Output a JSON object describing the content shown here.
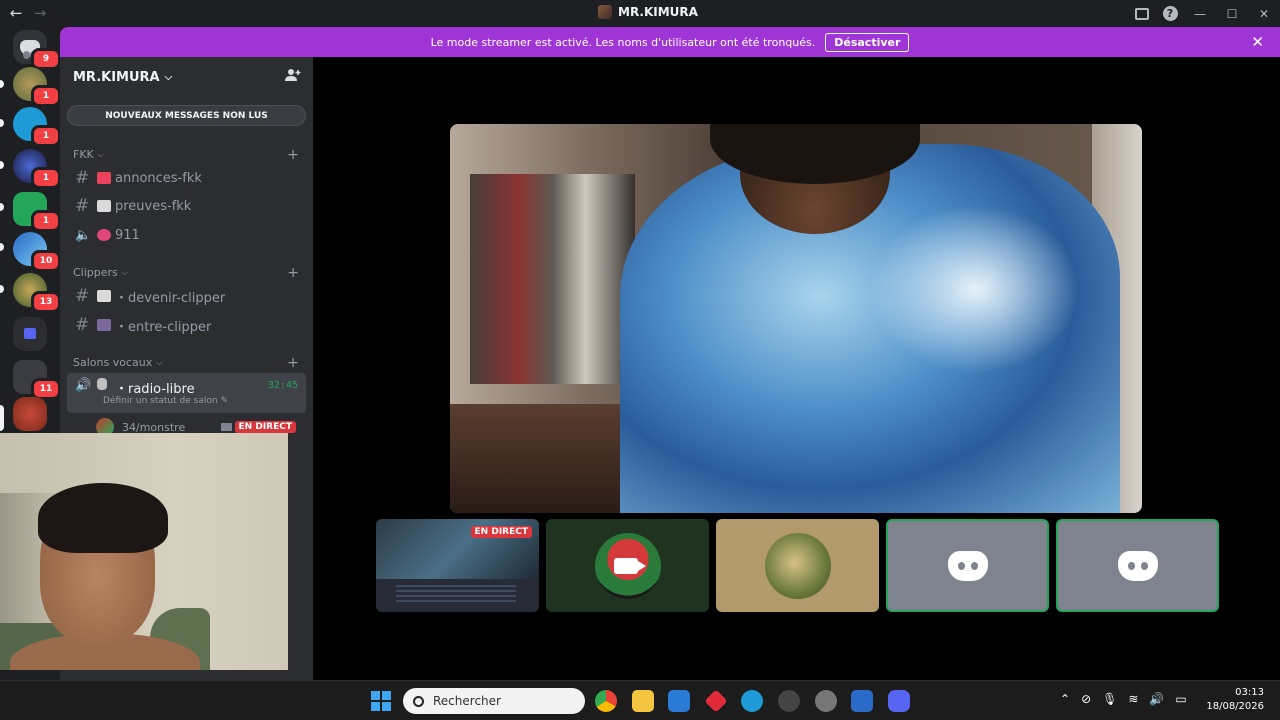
{
  "titlebar": {
    "title": "MR.KIMURA",
    "back_glyph": "←",
    "forward_glyph": "→",
    "minimize": "—",
    "maximize": "☐",
    "close": "✕",
    "help": "?"
  },
  "banner": {
    "message": "Le mode streamer est activé. Les noms d'utilisateur ont été tronqués.",
    "button": "Désactiver",
    "close": "✕"
  },
  "rail": {
    "badges": [
      "9",
      "1",
      "1",
      "1",
      "1",
      "10",
      "13",
      "11"
    ]
  },
  "sidebar": {
    "server_name": "MR.KIMURA",
    "chevron": "⌵",
    "unread_button": "NOUVEAUX MESSAGES NON LUS",
    "categories": [
      {
        "name": "FKK",
        "plus": "+"
      },
      {
        "name": "Clippers",
        "plus": "+"
      },
      {
        "name": "Salons vocaux",
        "plus": "+"
      }
    ],
    "channels": [
      {
        "name": "annonces-fkk",
        "icon": "#"
      },
      {
        "name": "preuves-fkk",
        "icon": "#"
      },
      {
        "name": "911",
        "icon": "speaker"
      },
      {
        "name": "・devenir-clipper",
        "icon": "#"
      },
      {
        "name": "・entre-clipper",
        "icon": "#"
      }
    ],
    "voice_channel": {
      "name": "・radio-libre",
      "status": "Définir un statut de salon",
      "timer": "32:45"
    },
    "voice_user": {
      "name": "34/monstre",
      "live": "EN DIRECT"
    }
  },
  "main": {
    "tiles": [
      {
        "type": "screen",
        "live": "EN DIRECT"
      },
      {
        "type": "camera-off"
      },
      {
        "type": "avatar"
      },
      {
        "type": "discord-default"
      },
      {
        "type": "discord-default"
      }
    ]
  },
  "taskbar": {
    "search_placeholder": "Rechercher",
    "time": "03:13",
    "date": "18/08/2026",
    "tray_icons": [
      "chevron-up",
      "network-off",
      "microphone",
      "wifi",
      "volume",
      "battery"
    ]
  },
  "colors": {
    "banner": "#a035d6",
    "live": "#da373c",
    "online": "#23a55a",
    "badge": "#f23f43"
  }
}
